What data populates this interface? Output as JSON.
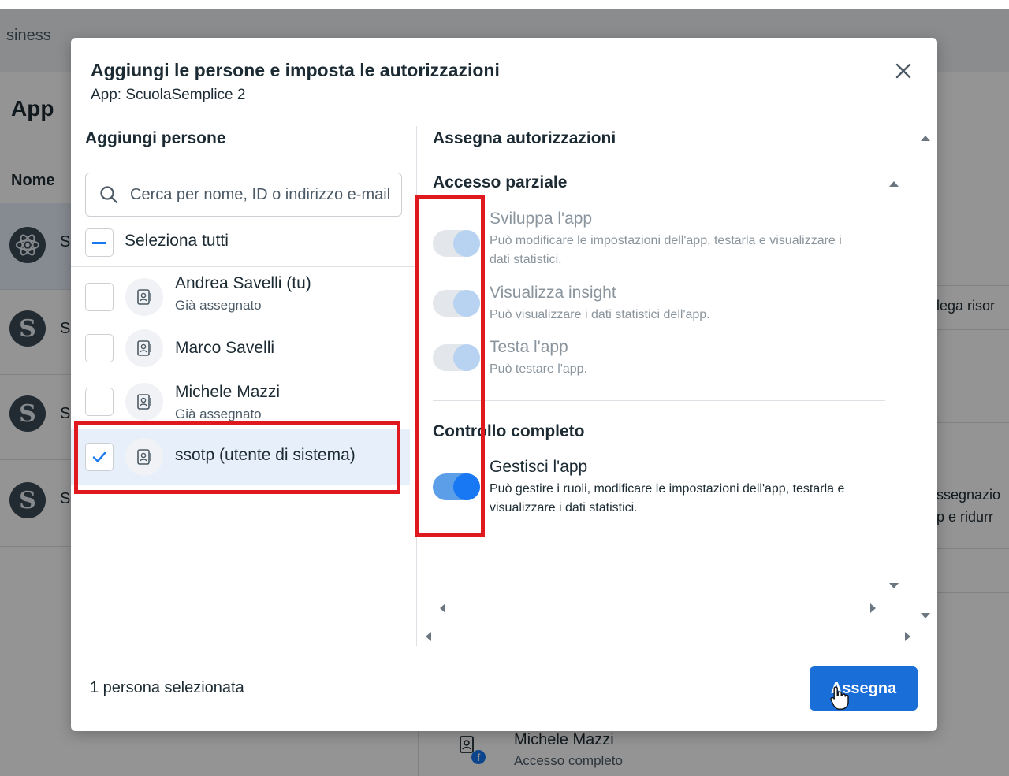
{
  "background": {
    "brand_fragment": "siness",
    "app_title": "App",
    "column_header": "Nome",
    "rows": [
      {
        "icon": "react-atom-icon",
        "initial": "S",
        "selected": true
      },
      {
        "icon": "letter-s-icon",
        "initial": "S",
        "selected": false
      },
      {
        "icon": "letter-s-icon",
        "initial": "S",
        "selected": false
      },
      {
        "icon": "letter-s-icon",
        "initial": "S",
        "selected": false
      }
    ],
    "right_fragments": {
      "row1": "lega risor",
      "row3_line1": "ssegnazio",
      "row3_line2": "p e ridurr"
    },
    "member": {
      "name": "Michele Mazzi",
      "access": "Accesso completo"
    }
  },
  "modal": {
    "title": "Aggiungi le persone e imposta le autorizzazioni",
    "subtitle": "App: ScuolaSemplice 2",
    "close_icon": "close-icon",
    "left_header": "Aggiungi persone",
    "right_header": "Assegna autorizzazioni",
    "search": {
      "placeholder": "Cerca per nome, ID o indirizzo e-mail",
      "value": ""
    },
    "select_all_label": "Seleziona tutti",
    "people": [
      {
        "name": "Andrea Savelli (tu)",
        "status": "Già assegnato",
        "checked": false
      },
      {
        "name": "Marco Savelli",
        "status": "",
        "checked": false
      },
      {
        "name": "Michele Mazzi",
        "status": "Già assegnato",
        "checked": false
      },
      {
        "name": "ssotp (utente di sistema)",
        "status": "",
        "checked": true
      }
    ],
    "partial_access": {
      "title": "Accesso parziale",
      "permissions": [
        {
          "title": "Sviluppa l'app",
          "desc": "Può modificare le impostazioni dell'app, testarla e visualizzare i dati statistici.",
          "on": true,
          "disabled": true
        },
        {
          "title": "Visualizza insight",
          "desc": "Può visualizzare i dati statistici dell'app.",
          "on": true,
          "disabled": true
        },
        {
          "title": "Testa l'app",
          "desc": "Può testare l'app.",
          "on": true,
          "disabled": true
        }
      ]
    },
    "full_control": {
      "title": "Controllo completo",
      "permissions": [
        {
          "title": "Gestisci l'app",
          "desc": "Può gestire i ruoli, modificare le impostazioni dell'app, testarla e visualizzare i dati statistici.",
          "on": true,
          "disabled": false
        }
      ]
    },
    "footer_count": "1 persona selezionata",
    "assign_button": "Assegna"
  },
  "colors": {
    "accent": "#1877f2",
    "button": "#1a6ed8",
    "highlight": "#e0191f",
    "selected_row": "#e7f0fa"
  }
}
